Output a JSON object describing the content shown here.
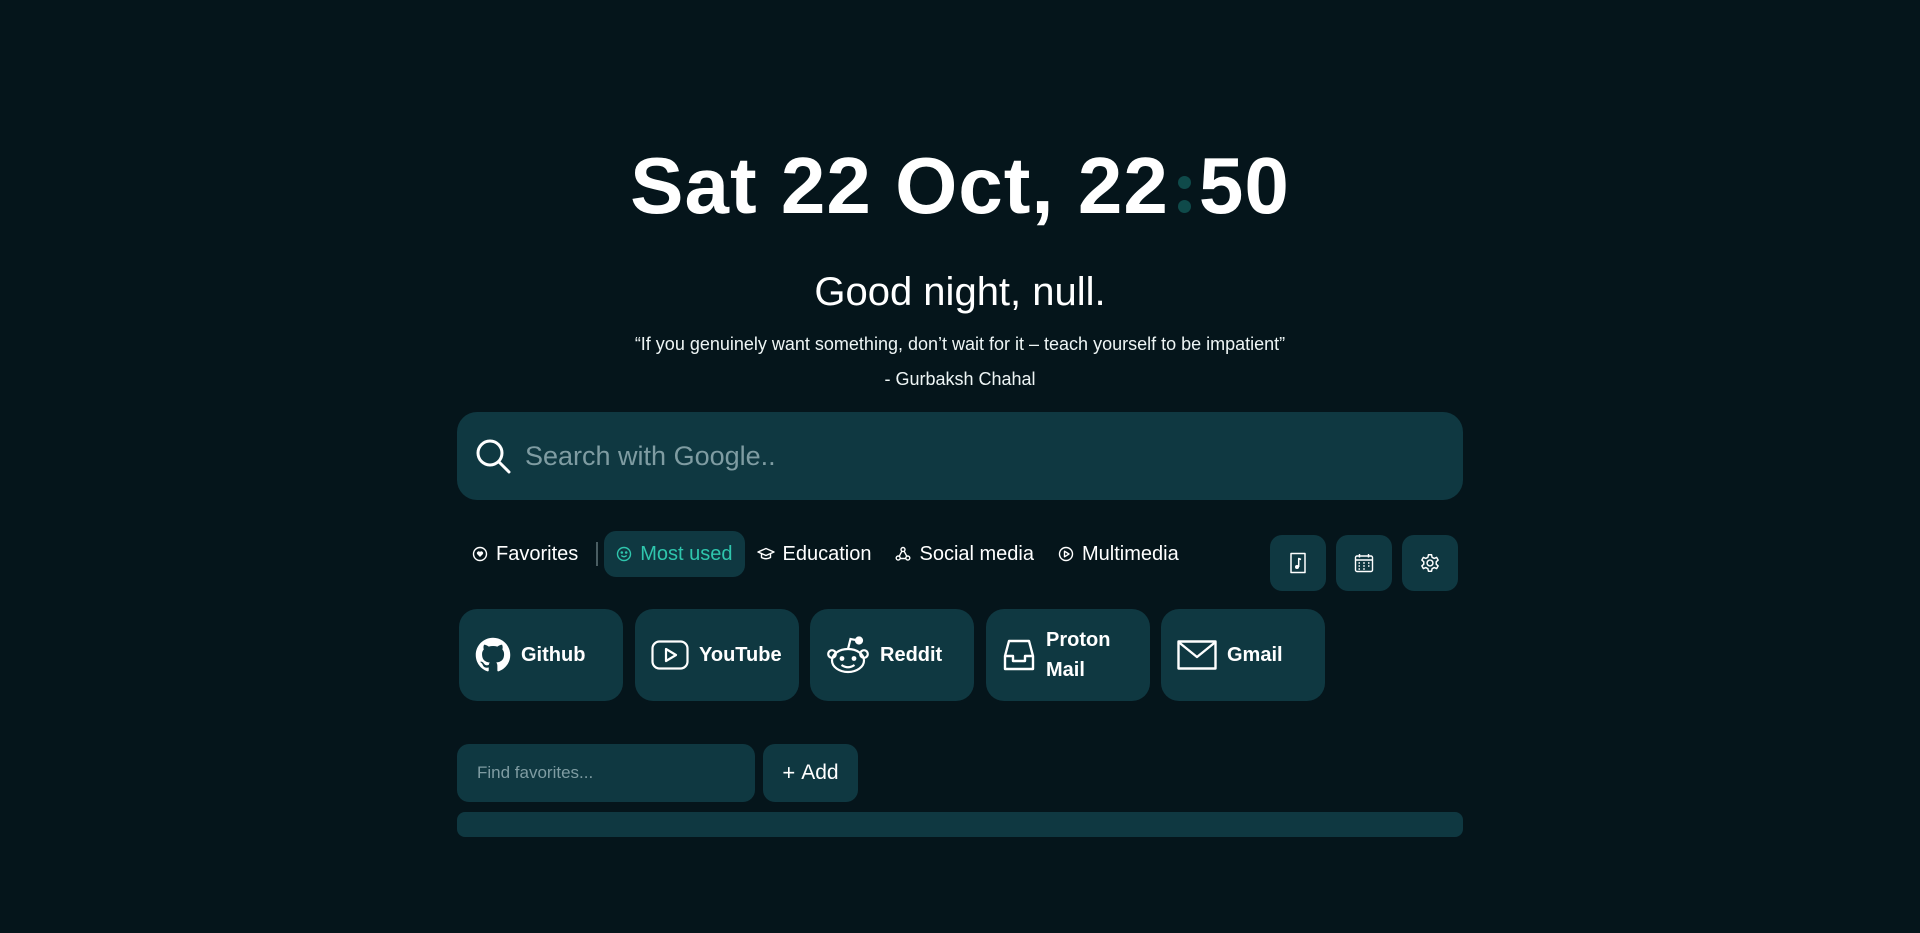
{
  "clock": {
    "date": "Sat 22 Oct, 22",
    "minutes": "50"
  },
  "greeting": "Good night, null.",
  "quote": {
    "text": "“If you genuinely want something, don’t wait for it – teach yourself to be impatient”",
    "author": "- Gurbaksh Chahal"
  },
  "search": {
    "placeholder": "Search with Google.."
  },
  "tabs": [
    {
      "label": "Favorites",
      "icon": "heart-circle-icon"
    },
    {
      "label": "Most used",
      "icon": "smile-icon",
      "active": true
    },
    {
      "label": "Education",
      "icon": "graduation-cap-icon"
    },
    {
      "label": "Social media",
      "icon": "share-icon"
    },
    {
      "label": "Multimedia",
      "icon": "play-circle-icon"
    }
  ],
  "tools": [
    {
      "icon": "music-note-icon"
    },
    {
      "icon": "calendar-icon"
    },
    {
      "icon": "gear-icon"
    }
  ],
  "links": [
    {
      "label": "Github",
      "icon": "github-icon"
    },
    {
      "label": "YouTube",
      "icon": "youtube-icon"
    },
    {
      "label": "Reddit",
      "icon": "reddit-icon"
    },
    {
      "label": "Proton\nMail",
      "line1": "Proton",
      "line2": "Mail",
      "icon": "inbox-icon"
    },
    {
      "label": "Gmail",
      "icon": "mail-icon"
    }
  ],
  "favorites": {
    "placeholder": "Find favorites...",
    "add_label": "Add"
  },
  "colors": {
    "background": "#05151b",
    "surface": "#0f3841",
    "accent": "#2fc6ad"
  }
}
